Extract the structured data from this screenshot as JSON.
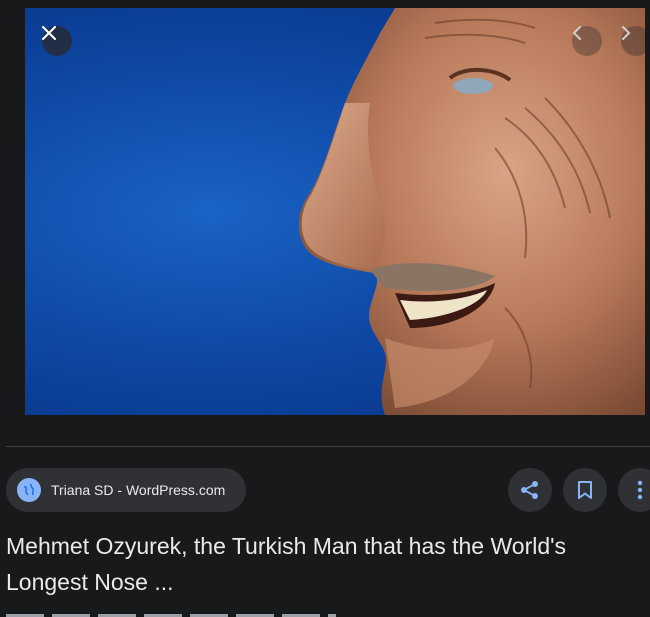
{
  "viewer": {
    "close_icon": "close-icon",
    "prev_icon": "chevron-left-icon",
    "next_icon": "chevron-right-icon"
  },
  "source": {
    "icon": "globe-icon",
    "label": "Triana SD - WordPress.com"
  },
  "actions": {
    "share_icon": "share-icon",
    "save_icon": "bookmark-icon",
    "more_icon": "more-vert-icon"
  },
  "result": {
    "title": "Mehmet Ozyurek, the Turkish Man that has the World's Longest Nose ..."
  },
  "colors": {
    "background": "#18191b",
    "chip": "#303134",
    "accent": "#8ab4f8",
    "image_background": "#1257b8"
  }
}
